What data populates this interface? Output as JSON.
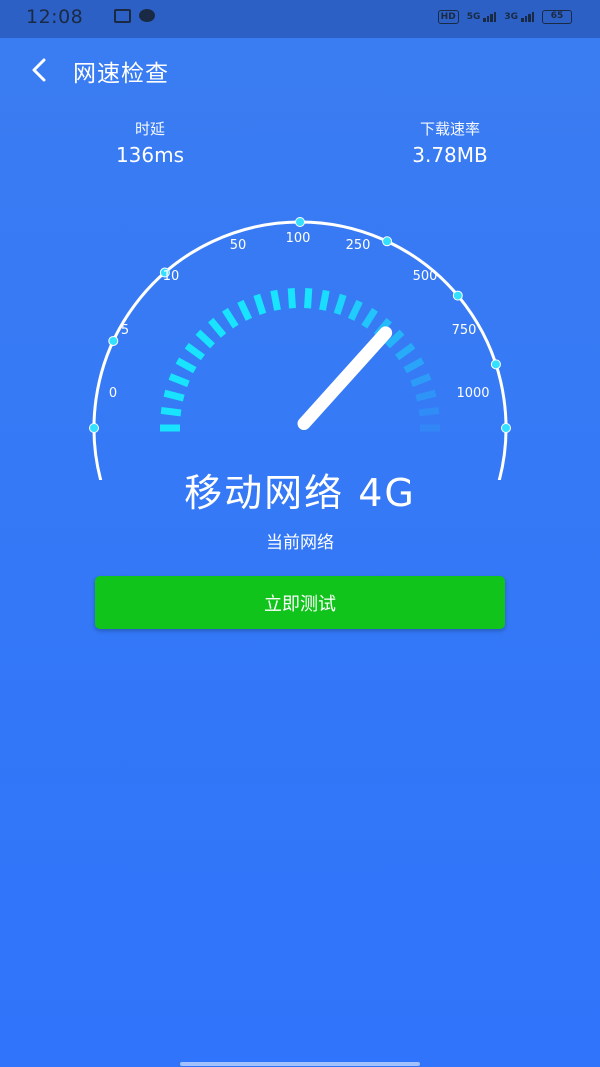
{
  "status_bar": {
    "time": "12:08",
    "hd_label": "HD",
    "network_1": "5G",
    "network_2": "3G",
    "battery": "65"
  },
  "header": {
    "title": "网速检查"
  },
  "stats": {
    "latency_label": "时延",
    "latency_value": "136ms",
    "download_label": "下载速率",
    "download_value": "3.78MB"
  },
  "gauge": {
    "tick_labels": [
      "0",
      "5",
      "10",
      "50",
      "100",
      "250",
      "500",
      "750",
      "1000"
    ],
    "needle_value": "500"
  },
  "network": {
    "name": "移动网络 4G",
    "subtitle": "当前网络"
  },
  "actions": {
    "test_button": "立即测试"
  },
  "colors": {
    "background": "#3579f6",
    "accent_cyan": "#18e4ff",
    "button_green": "#11c41b"
  }
}
